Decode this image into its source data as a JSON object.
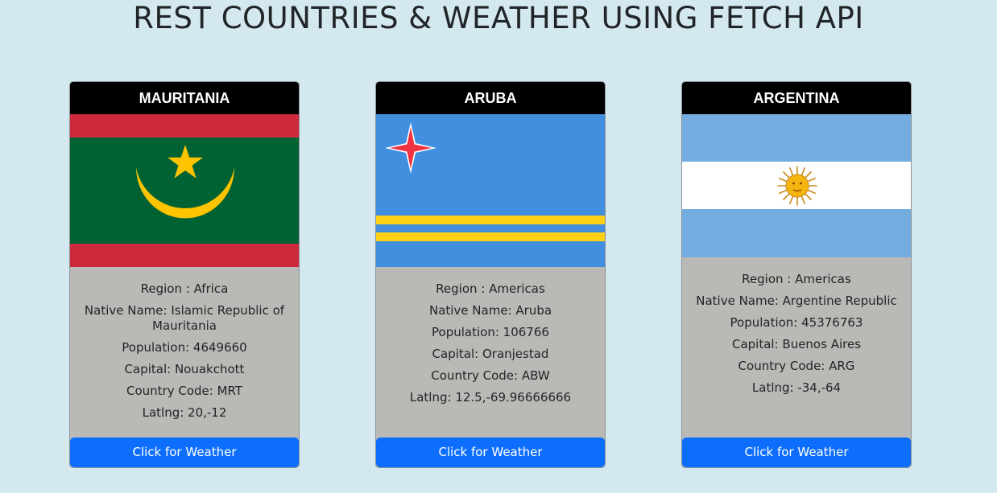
{
  "page": {
    "title": "REST COUNTRIES & WEATHER USING FETCH API"
  },
  "cards": [
    {
      "name": "MAURITANIA",
      "region": "Region : Africa",
      "native_name": "Native Name: Islamic Republic of Mauritania",
      "population": "Population: 4649660",
      "capital": "Capital: Nouakchott",
      "country_code": "Country Code: MRT",
      "latlng": "Latlng: 20,-12",
      "button_label": "Click for Weather"
    },
    {
      "name": "ARUBA",
      "region": "Region : Americas",
      "native_name": "Native Name: Aruba",
      "population": "Population: 106766",
      "capital": "Capital: Oranjestad",
      "country_code": "Country Code: ABW",
      "latlng": "Latlng: 12.5,-69.96666666",
      "button_label": "Click for Weather"
    },
    {
      "name": "ARGENTINA",
      "region": "Region : Americas",
      "native_name": "Native Name: Argentine Republic",
      "population": "Population: 45376763",
      "capital": "Capital: Buenos Aires",
      "country_code": "Country Code: ARG",
      "latlng": "Latlng: -34,-64",
      "button_label": "Click for Weather"
    }
  ],
  "colors": {
    "background": "#d4e9ef",
    "card_body": "#b9b9b5",
    "header": "#000000",
    "button": "#0d6efd"
  }
}
